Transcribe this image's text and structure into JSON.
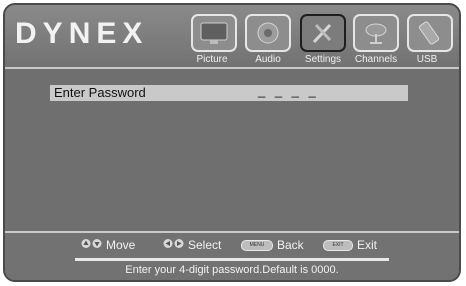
{
  "brand": {
    "letters": [
      "D",
      "Y",
      "N",
      "E",
      "X"
    ]
  },
  "tabs": [
    {
      "label": "Picture",
      "icon": "tv-icon"
    },
    {
      "label": "Audio",
      "icon": "speaker-icon"
    },
    {
      "label": "Settings",
      "icon": "tools-icon"
    },
    {
      "label": "Channels",
      "icon": "satellite-dish-icon"
    },
    {
      "label": "USB",
      "icon": "usb-drive-icon"
    }
  ],
  "active_tab": "Settings",
  "password_row": {
    "label": "Enter Password",
    "value": "_ _ _ _"
  },
  "hints": {
    "move": "Move",
    "select": "Select",
    "back_key": "MENU",
    "back": "Back",
    "exit_key": "EXIT",
    "exit": "Exit"
  },
  "message": "Enter your 4-digit password.Default is 0000."
}
